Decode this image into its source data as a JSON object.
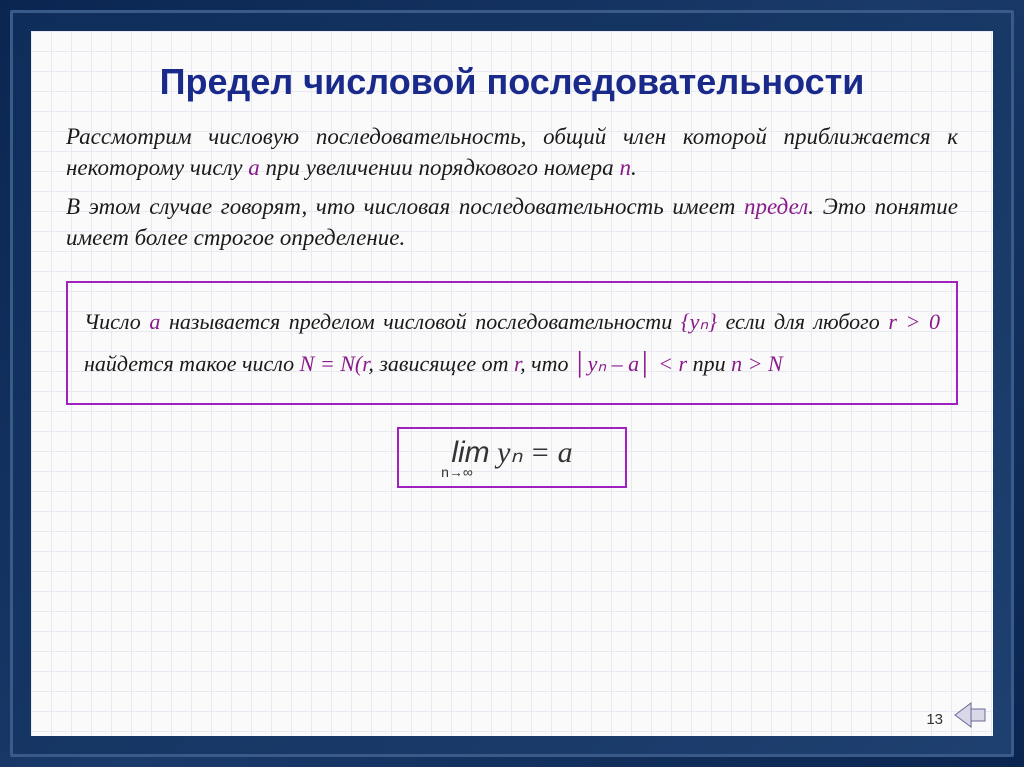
{
  "title": "Предел числовой последовательности",
  "intro": {
    "p1_a": "Рассмотрим числовую последовательность, общий член которой приближается к некоторому числу ",
    "p1_sym_a": "a",
    "p1_b": " при увеличении порядкового номера ",
    "p1_sym_n": "n",
    "p1_c": ".",
    "p2_a": "В этом случае говорят, что числовая последовательность имеет ",
    "p2_term": "предел",
    "p2_b": ". Это понятие имеет более строгое определение."
  },
  "definition": {
    "l1_a": "Число ",
    "l1_sym_a": "a",
    "l1_b": " называется пределом числовой последовательности ",
    "l1_sym_yn": "{yₙ}",
    "l2_a": "если для любого ",
    "l2_sym_r": "r > 0",
    "l2_b": "  найдется такое число ",
    "l2_sym_N": "N = N(r",
    "l2_c": ", зависящее от ",
    "l2_sym_r2": "r",
    "l2_d": ", что ",
    "l2_sym_abs": "│yₙ – a│",
    "l2_sym_lt": " < r",
    "l2_e": " при ",
    "l2_sym_ng": "n > N"
  },
  "formula": {
    "lim": "lim",
    "body": " yₙ = a",
    "sub": "n→∞"
  },
  "page_number": "13",
  "nav": {
    "back_icon": "back-arrow"
  }
}
